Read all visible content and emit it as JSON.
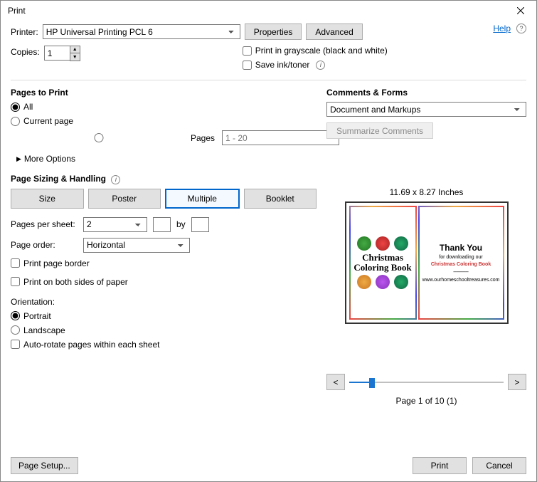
{
  "window": {
    "title": "Print"
  },
  "help": {
    "label": "Help"
  },
  "printer": {
    "label": "Printer:",
    "selected": "HP Universal Printing PCL 6",
    "properties_btn": "Properties",
    "advanced_btn": "Advanced"
  },
  "copies": {
    "label": "Copies:",
    "value": "1"
  },
  "grayscale": {
    "label": "Print in grayscale (black and white)"
  },
  "saveink": {
    "label": "Save ink/toner"
  },
  "pages_to_print": {
    "title": "Pages to Print",
    "all": "All",
    "current": "Current page",
    "pages": "Pages",
    "range_placeholder": "1 - 20",
    "more_options": "More Options"
  },
  "sizing": {
    "title": "Page Sizing & Handling",
    "size": "Size",
    "poster": "Poster",
    "multiple": "Multiple",
    "booklet": "Booklet"
  },
  "pps": {
    "label": "Pages per sheet:",
    "value": "2",
    "by": "by"
  },
  "page_order": {
    "label": "Page order:",
    "value": "Horizontal"
  },
  "print_border": {
    "label": "Print page border"
  },
  "both_sides": {
    "label": "Print on both sides of paper"
  },
  "orientation": {
    "title": "Orientation:",
    "portrait": "Portrait",
    "landscape": "Landscape",
    "autorotate": "Auto-rotate pages within each sheet"
  },
  "comments": {
    "title": "Comments & Forms",
    "value": "Document and Markups",
    "summarize_btn": "Summarize Comments"
  },
  "preview": {
    "dimensions": "11.69 x 8.27 Inches",
    "page_left_title": "Christmas Coloring Book",
    "page_right_thank": "Thank You",
    "page_right_for": "for downloading our",
    "page_right_sub": "Christmas Coloring Book",
    "page_right_url": "www.ourhomeschooltreasures.com",
    "page_of": "Page 1 of 10 (1)",
    "prev": "<",
    "next": ">"
  },
  "footer": {
    "page_setup": "Page Setup...",
    "print": "Print",
    "cancel": "Cancel"
  }
}
